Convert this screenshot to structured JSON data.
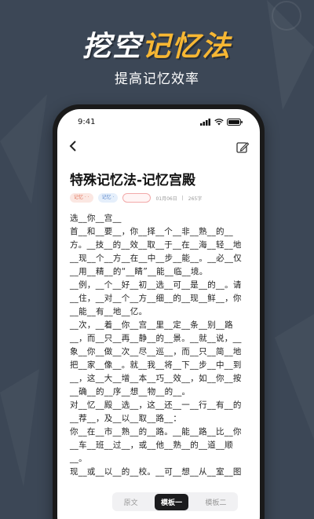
{
  "promo": {
    "title_part1": "挖空",
    "title_part2": "记忆法",
    "subtitle": "提高记忆效率"
  },
  "status": {
    "time": "9:41"
  },
  "nav": {
    "back_icon": "chevron-left-icon",
    "edit_icon": "edit-icon"
  },
  "doc": {
    "title": "特殊记忆法-记忆宫殿",
    "tags": [
      "记忆 · ·",
      "记忆 ·"
    ],
    "date": "01月06日",
    "word_count": "265字",
    "paragraphs": [
      "选__你__宫__",
      "首__和__要__，你__择__个__非__熟__的__方。__技__的__效__取__于__在__海__轻__地__现__个__方__在__中__步__能__。__必__仅__用__精__的“__睛”__能__临__境。",
      "__例，__个__好__初__选__可__是__的__。请__住，__对__个__方__细__的__现__鲜__，你__能__有__地__亿。",
      "__次，__着__你__宫__里__定__条__别__路__，而__只__再__静__的__景。__就__说，__象__你__做__次__尽__巡__，而__只__简__地把__家__像__。就__我__将__下__步__中__到__，这__大__增__本__巧__效__，如__你__按__确__的__序__想__物__的__。",
      "对__忆__殿__选__，这__还__一__行__有__的__荐__，及__以__取__路__：",
      "你__在__市__熟__的__路。__能__路__比__你__车__班__过__，或__他__熟__的__道__顺__。",
      "现__或__以__的__校。__可__想__从__室__图"
    ]
  },
  "tabs": {
    "items": [
      "原文",
      "模板一",
      "模板二"
    ],
    "active_index": 1
  },
  "colors": {
    "background": "#3c4756",
    "accent": "#f7b733",
    "active_tab": "#1c1c1e"
  }
}
